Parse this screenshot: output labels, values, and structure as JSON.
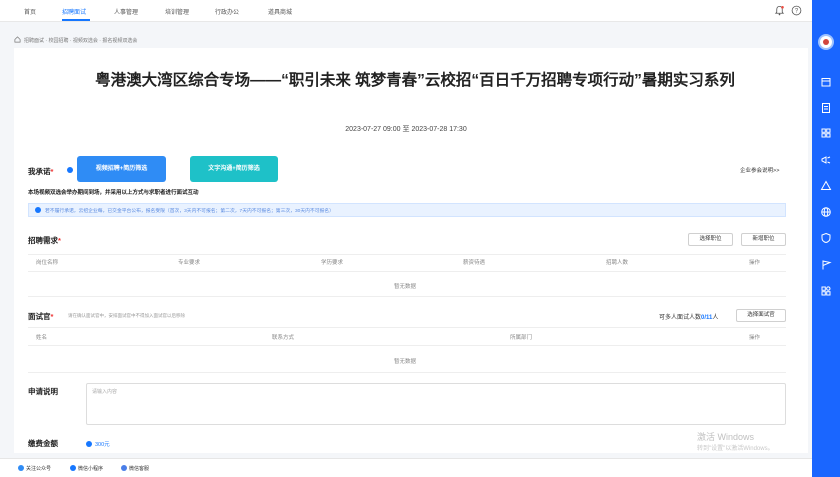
{
  "nav": {
    "items": [
      "首页",
      "招聘面试",
      "人事管理",
      "培训管理",
      "行政办公",
      "道具商城"
    ],
    "active_index": 1
  },
  "breadcrumb": "招聘面试 · 校园招聘 · 视频双选会 · 报名视频双选会",
  "event": {
    "title": "粤港澳大湾区综合专场——“职引未来 筑梦青春”云校招“百日千万招聘专项行动”暑期实习系列",
    "start": "2023-07-27 09:00",
    "range_sep": "至",
    "end": "2023-07-28 17:30"
  },
  "promise": {
    "label": "我承诺",
    "option1": "视频招聘+简历筛选",
    "option2": "文字沟通+简历筛选",
    "note": "本场视频双选会举办期间到场，并采用以上方式与求职者进行面试互动",
    "company_link": "企业参会说明>>",
    "info": "若不履行承诺，云招企业每，已交金平台公布，报名受限（首次，3天内不可报名；第二次，7天内不可报名；第三次，30天内不可报名）"
  },
  "recruit": {
    "label": "招聘需求",
    "select_btn": "选择职位",
    "add_btn": "新增职位",
    "columns": [
      "岗位名称",
      "专业要求",
      "学历要求",
      "薪资待遇",
      "招聘人数",
      "操作"
    ],
    "empty": "暂无数据"
  },
  "interviewer": {
    "label": "面试官",
    "hint": "请在确认面试官中，安排面试官中不得加入面试官以后移除",
    "count_label": "可多人面试人数",
    "count_value": "0/11",
    "count_unit": "人",
    "select_btn": "选择面试官",
    "columns": [
      "姓名",
      "联系方式",
      "所属部门",
      "操作"
    ],
    "empty": "暂无数据"
  },
  "application": {
    "label": "申请说明",
    "placeholder": "请输入内容"
  },
  "deposit": {
    "label": "缴费金额",
    "amount": "300元"
  },
  "watermark": {
    "line1": "激活 Windows",
    "line2": "转到\"设置\"以激活Windows。"
  },
  "bottom": {
    "items": [
      "关注公众号",
      "微信小程序",
      "微信客服"
    ]
  },
  "colors": {
    "brand_blue": "#1677ff",
    "sidebar_blue": "#1a66ff",
    "promise_btn1": "#2f8cf5",
    "promise_btn2": "#1ec1c8"
  }
}
